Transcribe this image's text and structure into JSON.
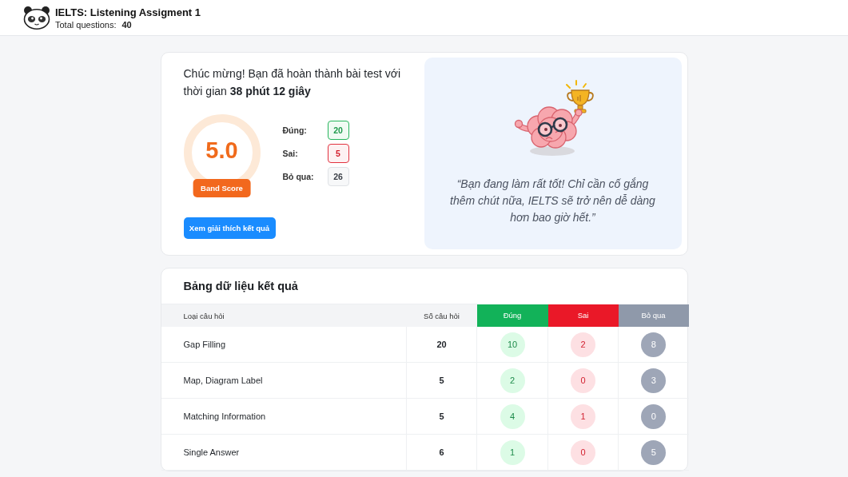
{
  "header": {
    "title": "IELTS: Listening Assigment 1",
    "total_label": "Total questions:",
    "total_value": "40"
  },
  "summary": {
    "message": "Chúc mừng! Bạn đã hoàn thành bài test với thời gian **38 phút 12 giây**",
    "score": "5.0",
    "score_label": "Band Score",
    "stats": [
      {
        "kind": "correct",
        "label": "Đúng:",
        "value": "20"
      },
      {
        "kind": "wrong",
        "label": "Sai:",
        "value": "5"
      },
      {
        "kind": "skipped",
        "label": "Bỏ qua:",
        "value": "26"
      }
    ],
    "button": "Xem giải thích kết quả",
    "quote": "“Bạn đang làm rất tốt! Chỉ cần cố gắng thêm chút nữa, IELTS sẽ trở nên dễ dàng hơn bao giờ hết.”"
  },
  "results_table": {
    "title": "Bảng dữ liệu kết quả",
    "columns": [
      {
        "kind": "type",
        "label": "Loại câu hỏi"
      },
      {
        "kind": "count",
        "label": "Số câu hỏi"
      },
      {
        "kind": "correct",
        "label": "Đúng"
      },
      {
        "kind": "wrong",
        "label": "Sai"
      },
      {
        "kind": "skipped",
        "label": "Bỏ qua"
      }
    ],
    "rows": [
      {
        "type": "Gap Filling",
        "count": "20",
        "correct": "10",
        "wrong": "2",
        "skipped": "8"
      },
      {
        "type": "Map, Diagram Label",
        "count": "5",
        "correct": "2",
        "wrong": "0",
        "skipped": "3"
      },
      {
        "type": "Matching Information",
        "count": "5",
        "correct": "4",
        "wrong": "1",
        "skipped": "0"
      },
      {
        "type": "Single Answer",
        "count": "6",
        "correct": "1",
        "wrong": "0",
        "skipped": "5"
      }
    ]
  }
}
